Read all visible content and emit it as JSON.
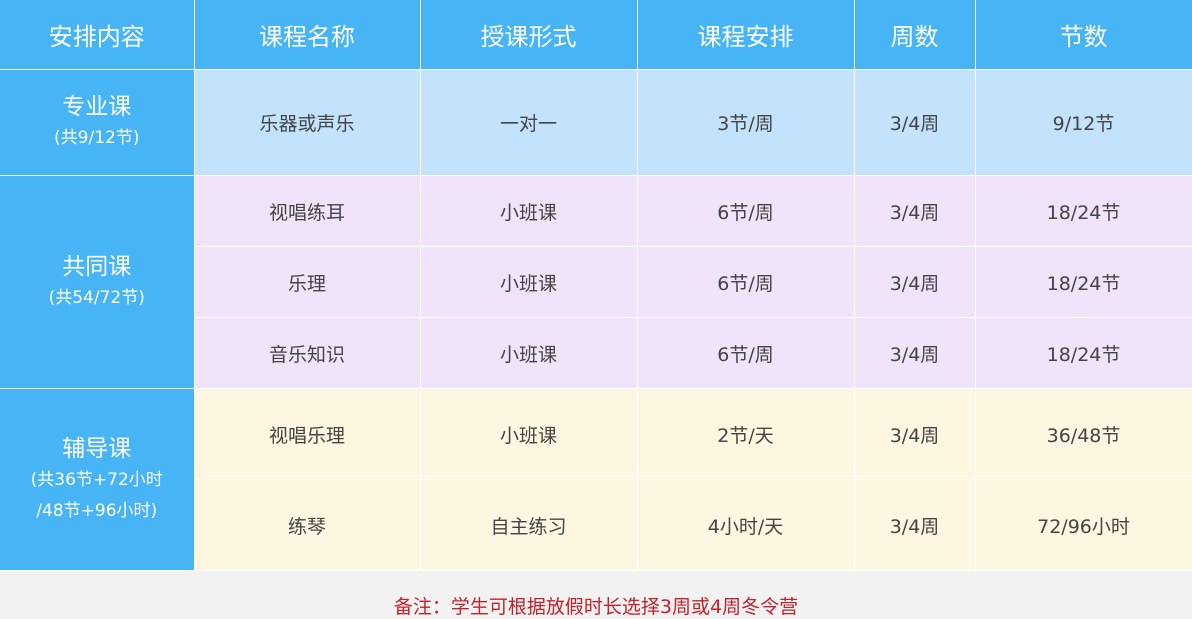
{
  "headers": [
    "安排内容",
    "课程名称",
    "授课形式",
    "课程安排",
    "周数",
    "节数"
  ],
  "groups": [
    {
      "name": "专业课",
      "sub": [
        "(共9/12节)"
      ],
      "rows": [
        [
          "乐器或声乐",
          "一对一",
          "3节/周",
          "3/4周",
          "9/12节"
        ]
      ]
    },
    {
      "name": "共同课",
      "sub": [
        "(共54/72节)"
      ],
      "rows": [
        [
          "视唱练耳",
          "小班课",
          "6节/周",
          "3/4周",
          "18/24节"
        ],
        [
          "乐理",
          "小班课",
          "6节/周",
          "3/4周",
          "18/24节"
        ],
        [
          "音乐知识",
          "小班课",
          "6节/周",
          "3/4周",
          "18/24节"
        ]
      ]
    },
    {
      "name": "辅导课",
      "sub": [
        "(共36节+72小时",
        "/48节+96小时)"
      ],
      "rows": [
        [
          "视唱乐理",
          "小班课",
          "2节/天",
          "3/4周",
          "36/48节"
        ],
        [
          "练琴",
          "自主练习",
          "4小时/天",
          "3/4周",
          "72/96小时"
        ]
      ]
    }
  ],
  "note": "备注：学生可根据放假时长选择3周或4周冬令营",
  "colors": {
    "header": "#47b4f5",
    "group1_row": "#c3e3fc",
    "group2_row": "#f1e3fa",
    "group3_row": "#fdf6e0",
    "note": "#c4212b"
  }
}
